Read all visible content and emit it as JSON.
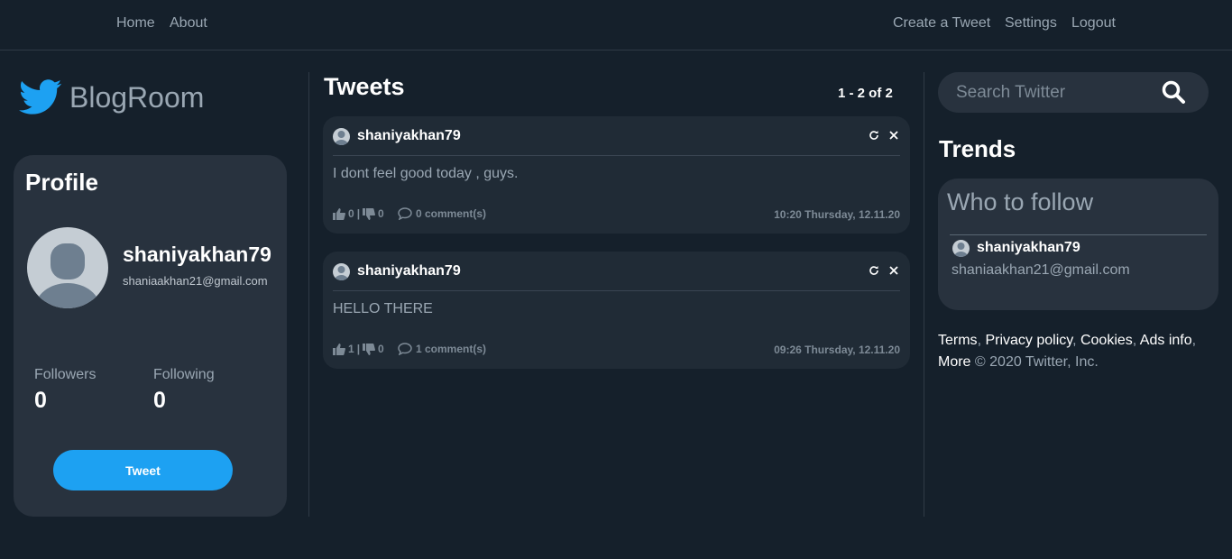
{
  "nav": {
    "home": "Home",
    "about": "About",
    "create": "Create a Tweet",
    "settings": "Settings",
    "logout": "Logout"
  },
  "brand": {
    "name": "BlogRoom",
    "icon": "twitter-bird-icon"
  },
  "profile": {
    "title": "Profile",
    "username": "shaniyakhan79",
    "email": "shaniaakhan21@gmail.com",
    "followers_label": "Followers",
    "followers": "0",
    "following_label": "Following",
    "following": "0",
    "tweet_button": "Tweet"
  },
  "feed": {
    "title": "Tweets",
    "pager": "1 - 2 of 2",
    "tweets": [
      {
        "user": "shaniyakhan79",
        "text": "I dont feel good today , guys.",
        "likes": "0",
        "dislikes": "0",
        "comments": "0 comment(s)",
        "time": "10:20 Thursday, 12.11.20"
      },
      {
        "user": "shaniyakhan79",
        "text": "HELLO THERE",
        "likes": "1",
        "dislikes": "0",
        "comments": "1 comment(s)",
        "time": "09:26 Thursday, 12.11.20"
      }
    ]
  },
  "sidebar": {
    "search_placeholder": "Search Twitter",
    "trends_title": "Trends",
    "who_to_follow": {
      "title": "Who to follow",
      "user": "shaniyakhan79",
      "email": "shaniaakhan21@gmail.com"
    },
    "footer": {
      "terms": "Terms",
      "privacy": "Privacy policy",
      "cookies": "Cookies",
      "ads": "Ads info",
      "more": "More",
      "copyright": "© 2020 Twitter, Inc."
    }
  },
  "colors": {
    "background": "#15202b",
    "card": "#28323e",
    "accent": "#1da1f2"
  }
}
